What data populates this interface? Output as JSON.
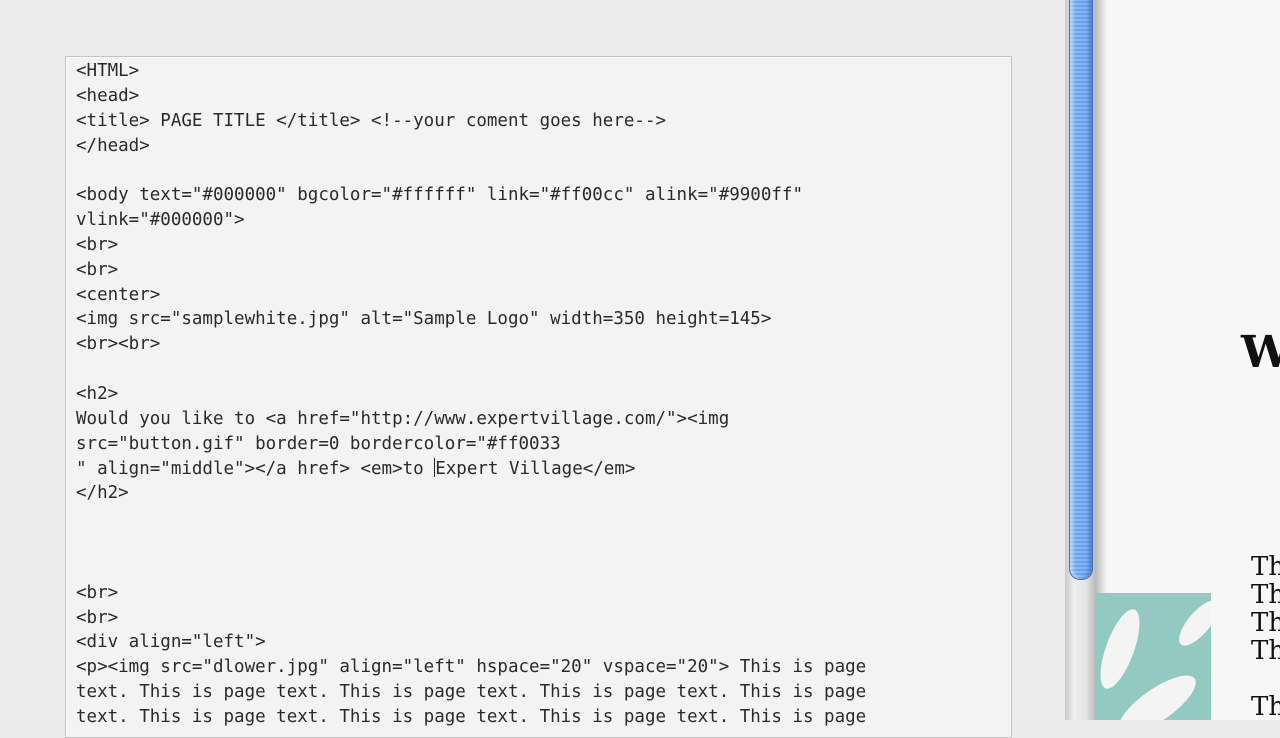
{
  "editor": {
    "lines": [
      "<HTML>",
      "<head>",
      "<title> PAGE TITLE </title> <!--your coment goes here-->",
      "</head>",
      "",
      "<body text=\"#000000\" bgcolor=\"#ffffff\" link=\"#ff00cc\" alink=\"#9900ff\"",
      "vlink=\"#000000\">",
      "<br>",
      "<br>",
      "<center>",
      "<img src=\"samplewhite.jpg\" alt=\"Sample Logo\" width=350 height=145>",
      "<br><br>",
      "",
      "<h2>",
      "Would you like to <a href=\"http://www.expertvillage.com/\"><img",
      "src=\"button.gif\" border=0 bordercolor=\"#ff0033",
      "",
      "</h2>",
      "",
      "",
      "",
      "<br>",
      "<br>",
      "<div align=\"left\">",
      "<p><img src=\"dlower.jpg\" align=\"left\" hspace=\"20\" vspace=\"20\"> This is page",
      "text. This is page text. This is page text. This is page text. This is page",
      "text. This is page text. This is page text. This is page text. This is page"
    ],
    "caret_line": {
      "before": "\" align=\"middle\"></a href> <em>to ",
      "after": "Expert Village</em>"
    }
  },
  "preview": {
    "heading": "W",
    "lines": [
      "Th",
      "Th",
      "Th",
      "Th",
      "",
      "Th"
    ]
  },
  "colors": {
    "scroll_thumb": "#6aa0ec",
    "preview_image": "#93c9c1"
  }
}
